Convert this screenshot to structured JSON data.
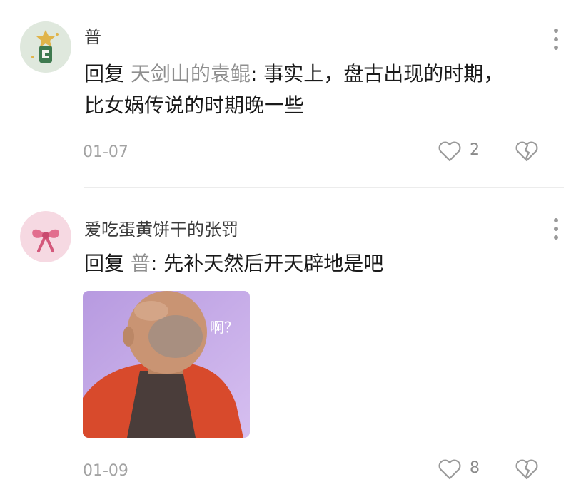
{
  "comments": [
    {
      "username": "普",
      "reply_prefix": "回复",
      "reply_to": "天剑山的袁鲲",
      "separator": ": ",
      "line1": "事实上，盘古出现的时期，",
      "line2": "比女娲传说的时期晚一些",
      "date": "01-07",
      "likes": "2",
      "like_icon": "heart-outline-icon",
      "dislike_icon": "broken-heart-icon",
      "more_icon": "vertical-dots-icon"
    },
    {
      "username": "爱吃蛋黄饼干的张罚",
      "reply_prefix": "回复",
      "reply_to": "普",
      "separator": ": ",
      "line1": "先补天然后开天辟地是吧",
      "meme_caption": "啊？",
      "date": "01-09",
      "likes": "8",
      "like_icon": "heart-outline-icon",
      "dislike_icon": "broken-heart-icon",
      "more_icon": "vertical-dots-icon"
    }
  ],
  "colors": {
    "username": "#3a3a3a",
    "reply_target": "#8e8e8e",
    "meta": "#a3a3a3",
    "icon": "#9a9a9a",
    "meme_background": "#c7a6e6"
  }
}
